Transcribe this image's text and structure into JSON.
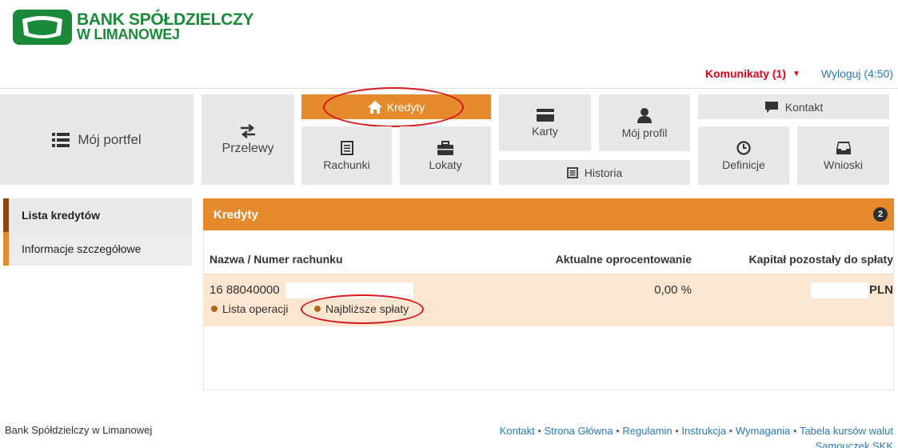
{
  "bank": {
    "line1": "BANK SPÓŁDZIELCZY",
    "line2": "W LIMANOWEJ"
  },
  "topbar": {
    "messages": "Komunikaty (1)",
    "logout": "Wyloguj (4:50)"
  },
  "nav": {
    "portfel": "Mój portfel",
    "przelewy": "Przelewy",
    "kredyty": "Kredyty",
    "rachunki": "Rachunki",
    "lokaty": "Lokaty",
    "karty": "Karty",
    "profil": "Mój profil",
    "historia": "Historia",
    "kontakt": "Kontakt",
    "definicje": "Definicje",
    "wnioski": "Wnioski"
  },
  "sidebar": {
    "items": [
      {
        "label": "Lista kredytów"
      },
      {
        "label": "Informacje szczegółowe"
      }
    ]
  },
  "panel": {
    "title": "Kredyty",
    "count": "2",
    "columns": [
      "Nazwa / Numer rachunku",
      "Aktualne oprocentowanie",
      "Kapitał pozostały do spłaty"
    ],
    "row": {
      "account": "16 88040000",
      "link_ops": "Lista operacji",
      "link_payments": "Najbliższe spłaty",
      "rate": "0,00 %",
      "currency": "PLN"
    }
  },
  "footer": {
    "left": "Bank Spółdzielczy w Limanowej",
    "links": [
      "Kontakt",
      "Strona Główna",
      "Regulamin",
      "Instrukcja",
      "Wymagania",
      "Tabela kursów walut",
      "Samouczek SKK"
    ],
    "separator": "•"
  },
  "colors": {
    "orange": "#e68a2e",
    "brown": "#8b4513",
    "green": "#1a8a3a",
    "red": "#e0001a",
    "link": "#2a7ac0"
  }
}
